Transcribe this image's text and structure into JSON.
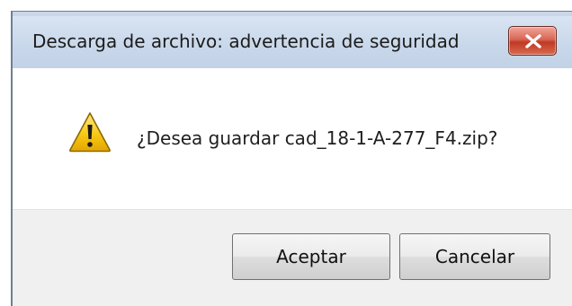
{
  "window": {
    "title": "Descarga de archivo: advertencia de seguridad"
  },
  "titlebar": {
    "close_icon": "close-icon",
    "close_color": "#c8432c"
  },
  "content": {
    "icon": "warning-icon",
    "message": "¿Desea guardar cad_18-1-A-277_F4.zip?"
  },
  "buttons": {
    "accept_label": "Aceptar",
    "cancel_label": "Cancelar"
  }
}
